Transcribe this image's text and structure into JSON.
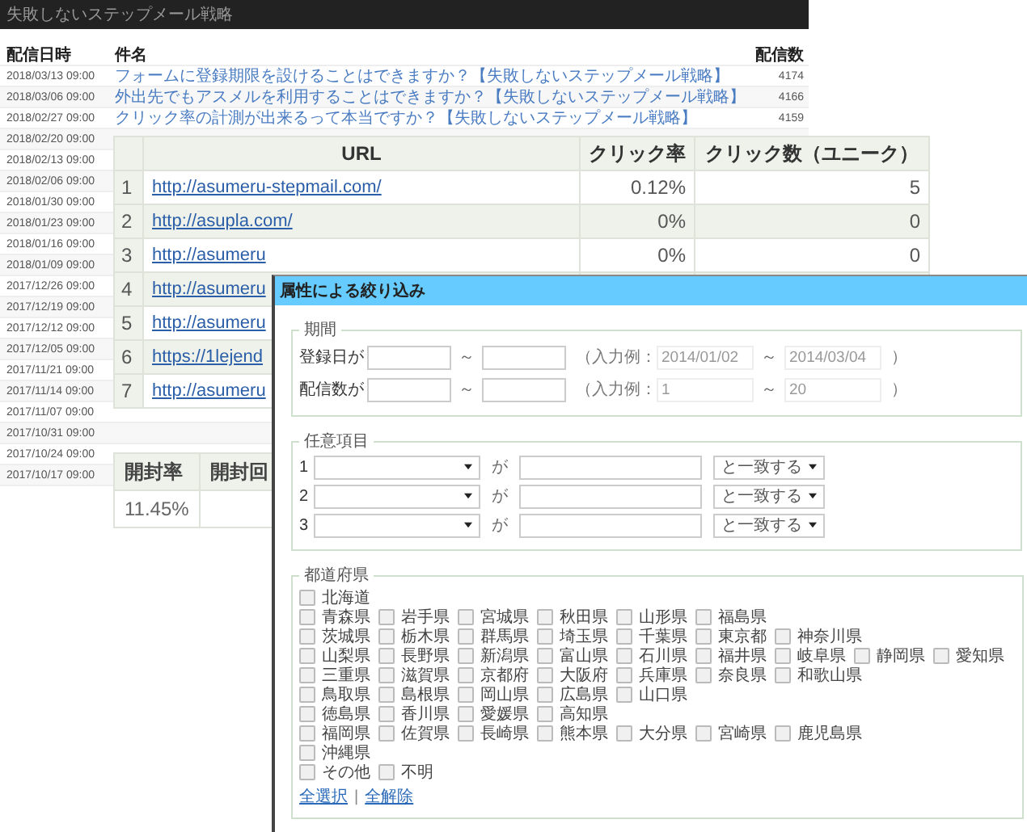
{
  "page": {
    "title": "失敗しないステップメール戦略",
    "columns": [
      "配信日時",
      "件名",
      "配信数"
    ],
    "rows": [
      {
        "date": "2018/03/13 09:00",
        "subject": "フォームに登録期限を設けることはできますか？【失敗しないステップメール戦略】",
        "count": "4174"
      },
      {
        "date": "2018/03/06 09:00",
        "subject": "外出先でもアスメルを利用することはできますか？【失敗しないステップメール戦略】",
        "count": "4166"
      },
      {
        "date": "2018/02/27 09:00",
        "subject": "クリック率の計測が出来るって本当ですか？【失敗しないステップメール戦略】",
        "count": "4159"
      },
      {
        "date": "2018/02/20 09:00"
      },
      {
        "date": "2018/02/13 09:00"
      },
      {
        "date": "2018/02/06 09:00"
      },
      {
        "date": "2018/01/30 09:00"
      },
      {
        "date": "2018/01/23 09:00"
      },
      {
        "date": "2018/01/16 09:00"
      },
      {
        "date": "2018/01/09 09:00"
      },
      {
        "date": "2017/12/26 09:00"
      },
      {
        "date": "2017/12/19 09:00"
      },
      {
        "date": "2017/12/12 09:00"
      },
      {
        "date": "2017/12/05 09:00"
      },
      {
        "date": "2017/11/21 09:00"
      },
      {
        "date": "2017/11/14 09:00"
      },
      {
        "date": "2017/11/07 09:00"
      },
      {
        "date": "2017/10/31 09:00"
      },
      {
        "date": "2017/10/24 09:00"
      },
      {
        "date": "2017/10/17 09:00"
      }
    ]
  },
  "url_table": {
    "columns": [
      "URL",
      "クリック率",
      "クリック数（ユニーク）"
    ],
    "rows": [
      {
        "number": "1",
        "url": "http://asumeru-stepmail.com/",
        "rate": "0.12%",
        "clicks": "5"
      },
      {
        "number": "2",
        "url": "http://asupla.com/",
        "rate": "0%",
        "clicks": "0"
      },
      {
        "number": "3",
        "url": "http://asumeru",
        "rate": "0%",
        "clicks": "0"
      },
      {
        "number": "4",
        "url": "http://asumeru"
      },
      {
        "number": "5",
        "url": "http://asumeru"
      },
      {
        "number": "6",
        "url": "https://1lejend"
      },
      {
        "number": "7",
        "url": "http://asumeru"
      }
    ]
  },
  "open_table": {
    "columns": [
      "開封率",
      "開封回"
    ],
    "rows": [
      {
        "rate": "11.45%"
      }
    ]
  },
  "dialog": {
    "title": "属性による絞り込み",
    "period": {
      "legend": "期間",
      "rows": [
        {
          "label": "登録日が",
          "sep": "～",
          "example_label": "（入力例：",
          "example_from": "2014/01/02",
          "example_sep": "～",
          "example_to": "2014/03/04",
          "close": "）"
        },
        {
          "label": "配信数が",
          "sep": "～",
          "example_label": "（入力例：",
          "example_from": "1",
          "example_sep": "～",
          "example_to": "20",
          "close": "）"
        }
      ]
    },
    "custom": {
      "legend": "任意項目",
      "rows": [
        {
          "number": "1",
          "connector": "が",
          "match": "と一致する"
        },
        {
          "number": "2",
          "connector": "が",
          "match": "と一致する"
        },
        {
          "number": "3",
          "connector": "が",
          "match": "と一致する"
        }
      ]
    },
    "prefectures": {
      "legend": "都道府県",
      "rows": [
        [
          {
            "label": "北海道",
            "checked": false
          }
        ],
        [
          {
            "label": "青森県",
            "checked": false
          },
          {
            "label": "岩手県",
            "checked": false
          },
          {
            "label": "宮城県",
            "checked": false
          },
          {
            "label": "秋田県",
            "checked": false
          },
          {
            "label": "山形県",
            "checked": false
          },
          {
            "label": "福島県",
            "checked": false
          }
        ],
        [
          {
            "label": "茨城県",
            "checked": false
          },
          {
            "label": "栃木県",
            "checked": false
          },
          {
            "label": "群馬県",
            "checked": false
          },
          {
            "label": "埼玉県",
            "checked": false
          },
          {
            "label": "千葉県",
            "checked": false
          },
          {
            "label": "東京都",
            "checked": false
          },
          {
            "label": "神奈川県",
            "checked": false
          }
        ],
        [
          {
            "label": "山梨県",
            "checked": false
          },
          {
            "label": "長野県",
            "checked": false
          },
          {
            "label": "新潟県",
            "checked": false
          },
          {
            "label": "富山県",
            "checked": false
          },
          {
            "label": "石川県",
            "checked": false
          },
          {
            "label": "福井県",
            "checked": false
          },
          {
            "label": "岐阜県",
            "checked": false
          },
          {
            "label": "静岡県",
            "checked": false
          },
          {
            "label": "愛知県",
            "checked": false
          }
        ],
        [
          {
            "label": "三重県",
            "checked": false
          },
          {
            "label": "滋賀県",
            "checked": false
          },
          {
            "label": "京都府",
            "checked": false
          },
          {
            "label": "大阪府",
            "checked": false
          },
          {
            "label": "兵庫県",
            "checked": false
          },
          {
            "label": "奈良県",
            "checked": false
          },
          {
            "label": "和歌山県",
            "checked": false
          }
        ],
        [
          {
            "label": "鳥取県",
            "checked": false
          },
          {
            "label": "島根県",
            "checked": false
          },
          {
            "label": "岡山県",
            "checked": false
          },
          {
            "label": "広島県",
            "checked": false
          },
          {
            "label": "山口県",
            "checked": false
          }
        ],
        [
          {
            "label": "徳島県",
            "checked": false
          },
          {
            "label": "香川県",
            "checked": false
          },
          {
            "label": "愛媛県",
            "checked": false
          },
          {
            "label": "高知県",
            "checked": false
          }
        ],
        [
          {
            "label": "福岡県",
            "checked": false
          },
          {
            "label": "佐賀県",
            "checked": false
          },
          {
            "label": "長崎県",
            "checked": false
          },
          {
            "label": "熊本県",
            "checked": false
          },
          {
            "label": "大分県",
            "checked": false
          },
          {
            "label": "宮崎県",
            "checked": false
          },
          {
            "label": "鹿児島県",
            "checked": false
          }
        ],
        [
          {
            "label": "沖縄県",
            "checked": false
          }
        ],
        [
          {
            "label": "その他",
            "checked": false
          },
          {
            "label": "不明",
            "checked": false
          }
        ]
      ],
      "links": [
        "全選択",
        "全解除"
      ],
      "link_separator": "|"
    }
  }
}
